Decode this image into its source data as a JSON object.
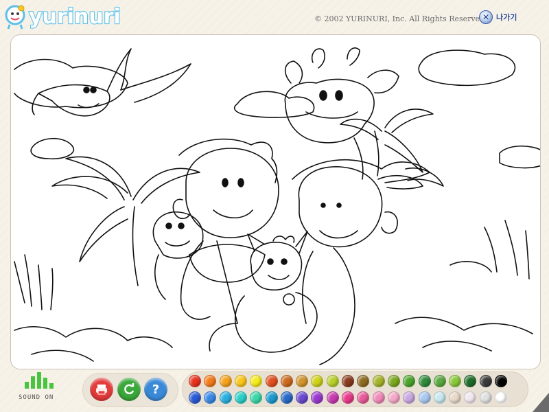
{
  "app": {
    "logo_text": "yurinuri",
    "copyright": "© 2002 YURINURI, Inc. All Rights Reserved.",
    "exit_label": "나가기",
    "exit_icon": "close-icon"
  },
  "sound": {
    "label": "SOUND ON",
    "color": "#49c43f"
  },
  "tools": [
    {
      "name": "print-button",
      "icon": "printer-icon",
      "color": "#e43b3b"
    },
    {
      "name": "reset-button",
      "icon": "refresh-icon",
      "color": "#3aa83a"
    },
    {
      "name": "help-button",
      "icon": "question-icon",
      "color": "#3a8ad8",
      "glyph": "?"
    }
  ],
  "palette": {
    "top_row": [
      "#e8321e",
      "#f57a19",
      "#f7a21b",
      "#fbc71b",
      "#f6ec1c",
      "#e1501f",
      "#cc6a1e",
      "#d2942e",
      "#cfd318",
      "#b8d02a",
      "#8a3a1e",
      "#8f6b22",
      "#a6b42a",
      "#7aa820",
      "#4aa52c",
      "#2e8a3a",
      "#5aa840",
      "#8ac83a",
      "#1e6a2a",
      "#3a3a3a",
      "#000000"
    ],
    "bottom_row": [
      "#2a5ad8",
      "#3a8ae8",
      "#2ab0e0",
      "#2ad0c8",
      "#3ad8a8",
      "#1e9ad0",
      "#2a6ac8",
      "#6a4ad0",
      "#9a3ad0",
      "#c83ab0",
      "#e83a8a",
      "#e85a9a",
      "#f08ab8",
      "#f5a8c8",
      "#c8a8e0",
      "#a8c8f0",
      "#c8e8f0",
      "#e8d8c8",
      "#f0e8f0",
      "#e0e0e0",
      "#ffffff"
    ]
  }
}
